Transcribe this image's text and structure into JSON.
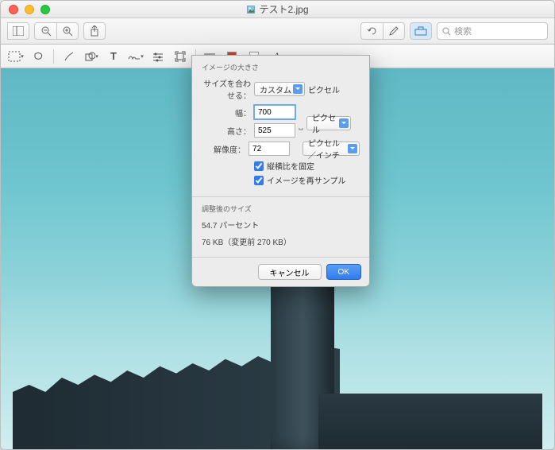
{
  "window": {
    "title": "テスト2.jpg"
  },
  "search": {
    "placeholder": "検索"
  },
  "dialog": {
    "section_label": "イメージの大きさ",
    "fit_label": "サイズを合わせる：",
    "fit_value": "カスタム",
    "fit_unit": "ピクセル",
    "width_label": "幅：",
    "width_value": "700",
    "height_label": "高さ：",
    "height_value": "525",
    "wh_unit": "ピクセル",
    "res_label": "解像度：",
    "res_value": "72",
    "res_unit": "ピクセル／インチ",
    "lock_ratio": "縦横比を固定",
    "resample": "イメージを再サンプル",
    "result_label": "調整後のサイズ",
    "result_percent": "54.7 パーセント",
    "result_size": "76 KB（変更前 270 KB）",
    "cancel": "キャンセル",
    "ok": "OK"
  }
}
